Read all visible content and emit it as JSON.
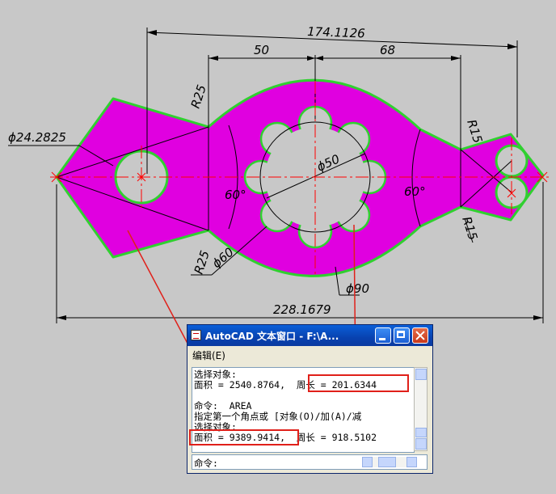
{
  "drawing": {
    "dimensions": {
      "overall_top": "174.1126",
      "top_left": "50",
      "top_right": "68",
      "overall_bottom": "228.1679",
      "hole_diameter": "ϕ24.2825",
      "center_diameter": "ϕ50",
      "arc_60": "ϕ60",
      "arc_90": "ϕ90",
      "radius_left_top": "R25",
      "radius_left_bottom": "R25",
      "radius_right_top": "R15",
      "radius_right_bottom": "R15",
      "angle_left": "60°",
      "angle_right": "60°"
    },
    "colors": {
      "fill": "#e000e0",
      "outline": "#30d030",
      "centerline": "#ff0000",
      "background": "#c8c8c8",
      "annotation_box": "#e0201a"
    }
  },
  "text_window": {
    "title": "AutoCAD 文本窗口 - F:\\A...",
    "menu_edit": "编辑(E)",
    "lines": [
      "选择对象:",
      "面积 = 2540.8764,  周长 = 201.6344",
      "",
      "命令:  AREA",
      "指定第一个角点或 [对象(O)/加(A)/减",
      "选择对象:",
      "面积 = 9389.9414,  周长 = 918.5102"
    ],
    "command_prompt": "命令:",
    "icons": [
      "window-app-icon",
      "minimize-icon",
      "maximize-icon",
      "close-icon"
    ]
  }
}
